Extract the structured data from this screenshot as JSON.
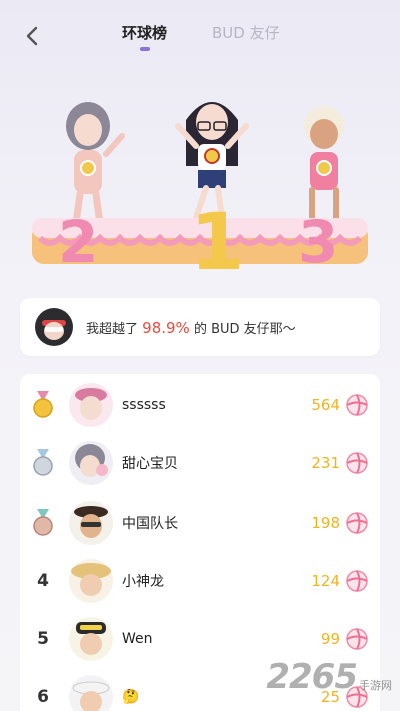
{
  "header": {
    "tabs": [
      {
        "label": "环球榜",
        "active": true
      },
      {
        "label": "BUD 友仔",
        "active": false
      }
    ]
  },
  "podium": {
    "places": [
      "2",
      "1",
      "3"
    ]
  },
  "beat_banner": {
    "prefix": "我超越了",
    "percent": "98.9%",
    "suffix": "的 BUD 友仔耶～"
  },
  "ranking": [
    {
      "rank": "1",
      "medal": "gold-medal-icon",
      "name": "ssssss",
      "score": "564"
    },
    {
      "rank": "2",
      "medal": "silver-medal-icon",
      "name": "甜心宝贝",
      "score": "231"
    },
    {
      "rank": "3",
      "medal": "bronze-medal-icon",
      "name": "中国队长",
      "score": "198"
    },
    {
      "rank": "4",
      "medal": "",
      "name": "小神龙",
      "score": "124"
    },
    {
      "rank": "5",
      "medal": "",
      "name": "Wen",
      "score": "99"
    },
    {
      "rank": "6",
      "medal": "",
      "name": "🤔",
      "score": "25"
    }
  ],
  "colors": {
    "accent": "#8a74d6",
    "score": "#f0b322",
    "percent": "#e84a3c",
    "podium_pink": "#f39bb8",
    "gold": "#f4c84a"
  },
  "watermark": {
    "big": "2265",
    "small": "手游网"
  }
}
